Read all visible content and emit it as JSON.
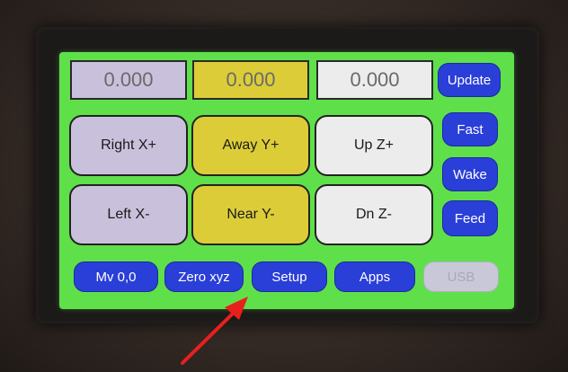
{
  "readouts": {
    "x": "0.000",
    "y": "0.000",
    "z": "0.000"
  },
  "jog": {
    "right_x": "Right X+",
    "away_y": "Away Y+",
    "up_z": "Up Z+",
    "left_x": "Left X-",
    "near_y": "Near Y-",
    "dn_z": "Dn Z-"
  },
  "side_buttons": {
    "update": "Update",
    "fast": "Fast",
    "wake": "Wake",
    "feed": "Feed"
  },
  "bottom_buttons": {
    "mv00": "Mv 0,0",
    "zero_xyz": "Zero xyz",
    "setup": "Setup",
    "apps": "Apps",
    "usb": "USB"
  },
  "colors": {
    "screen": "#5fe04a",
    "button_blue": "#2a3fd8",
    "x_column": "#c9c1dc",
    "y_column": "#dccd38",
    "z_column": "#ececec",
    "annotation_arrow": "#e8201c"
  },
  "annotation": {
    "type": "arrow",
    "points_to": "Setup"
  }
}
